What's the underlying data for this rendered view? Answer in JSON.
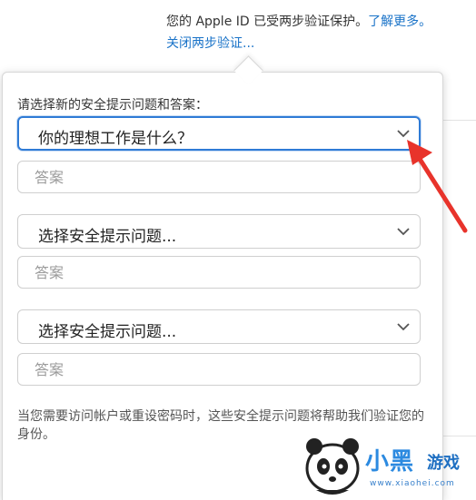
{
  "header": {
    "status_text": "您的 Apple ID 已受两步验证保护。",
    "learn_more": "了解更多。",
    "turn_off_link": "关闭两步验证..."
  },
  "form": {
    "prompt": "请选择新的安全提示问题和答案：",
    "questions": [
      {
        "selected": "你的理想工作是什么？",
        "answer_placeholder": "答案",
        "focused": true
      },
      {
        "selected": "选择安全提示问题...",
        "answer_placeholder": "答案",
        "focused": false
      },
      {
        "selected": "选择安全提示问题...",
        "answer_placeholder": "答案",
        "focused": false
      }
    ],
    "help_text": "当您需要访问帐户或重设密码时，这些安全提示问题将帮助我们验证您的身份。"
  },
  "annotation": {
    "arrow_color": "#e8332b"
  },
  "watermark": {
    "brand": "小黑",
    "brand_suffix": "游戏",
    "url": "www.xiaohei.com"
  },
  "colors": {
    "link": "#1a73c8",
    "focus": "#2f7bd6"
  }
}
